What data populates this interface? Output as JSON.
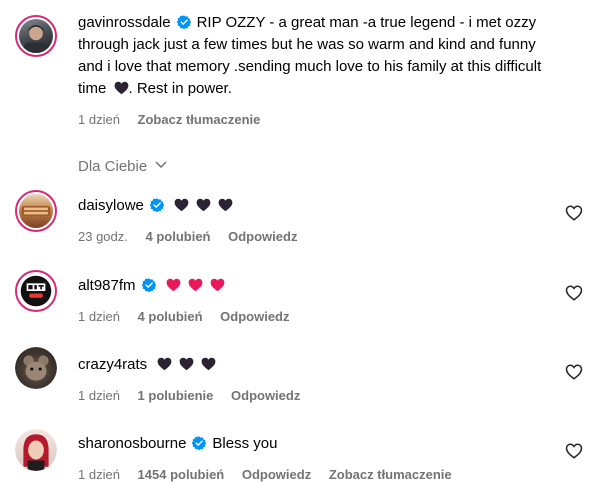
{
  "main_comment": {
    "username": "gavinrossdale",
    "text": "RIP OZZY - a great man -a true legend - i met ozzy through jack just a few times but he was so warm and kind and funny and i love that memory .sending much love to his family at this difficult time",
    "text_after_emoji": ". Rest in power.",
    "emoji": "black-heart",
    "time": "1 dzień",
    "translate": "Zobacz tłumaczenie"
  },
  "section": {
    "label": "Dla Ciebie",
    "chevron_icon": "chevron-down-icon"
  },
  "replies": [
    {
      "username": "daisylowe",
      "verified": true,
      "emojis": [
        "black-heart",
        "black-heart",
        "black-heart"
      ],
      "text": "",
      "time": "23 godz.",
      "likes": "4 polubień",
      "reply": "Odpowiedz"
    },
    {
      "username": "alt987fm",
      "verified": true,
      "emojis": [
        "pink-heart",
        "pink-heart",
        "pink-heart"
      ],
      "text": "",
      "time": "1 dzień",
      "likes": "4 polubień",
      "reply": "Odpowiedz"
    },
    {
      "username": "crazy4rats",
      "verified": false,
      "emojis": [
        "black-heart",
        "black-heart",
        "black-heart"
      ],
      "text": "",
      "time": "1 dzień",
      "likes": "1 polubienie",
      "reply": "Odpowiedz"
    },
    {
      "username": "sharonosbourne",
      "verified": true,
      "emojis": [],
      "text": "Bless you",
      "time": "1 dzień",
      "likes": "1454 polubień",
      "reply": "Odpowiedz",
      "translate": "Zobacz tłumaczenie"
    }
  ],
  "colors": {
    "verified": "#0095f6",
    "secondary_text": "#737373",
    "story_ring": "#d62976",
    "black_heart": "#2b2233",
    "pink_heart": "#e8185b"
  }
}
